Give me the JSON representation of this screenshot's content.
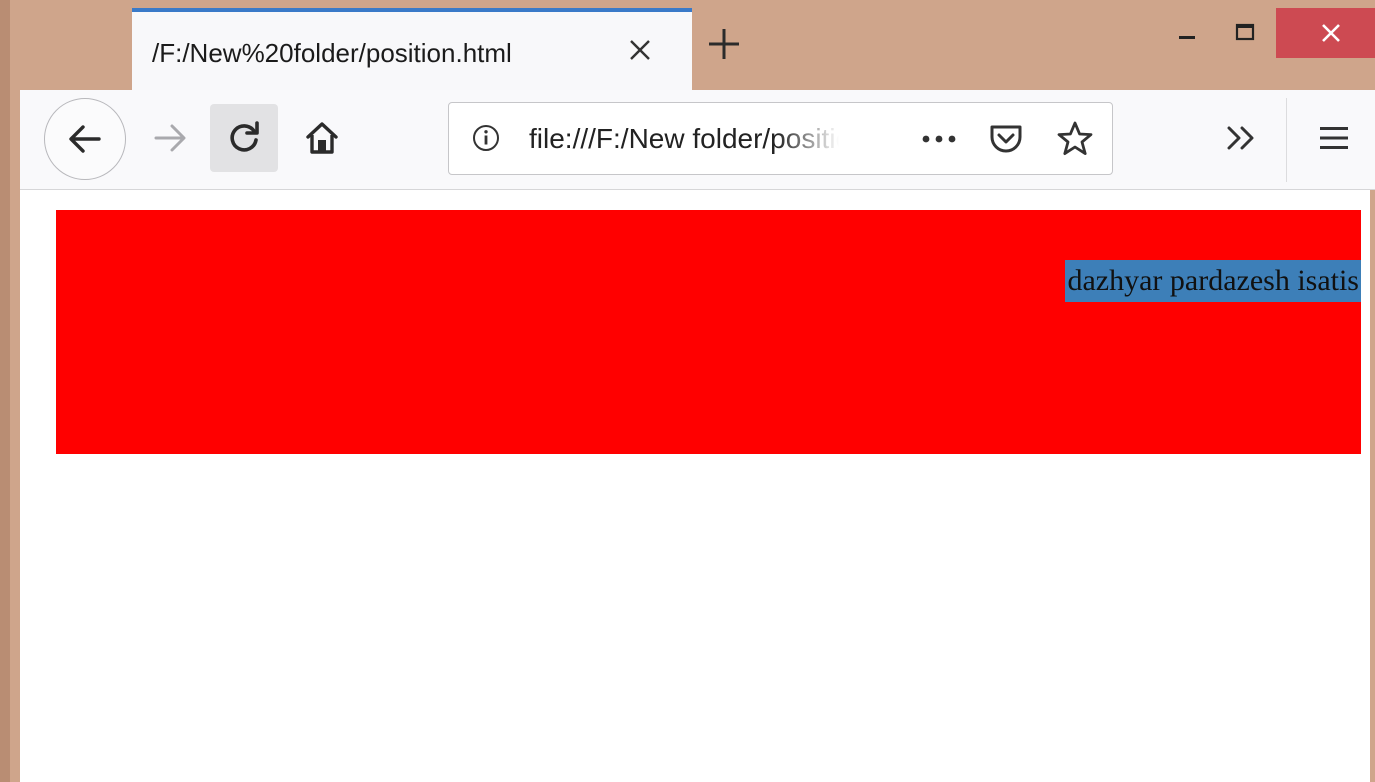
{
  "tab": {
    "title": "/F:/New%20folder/position.html"
  },
  "toolbar": {
    "url": "file:///F:/New folder/position.html"
  },
  "page": {
    "selected_text": "dazhyar pardazesh isatis"
  },
  "colors": {
    "tab_accent": "#3a7ac8",
    "window_frame": "#cfa58b",
    "close_button": "#cd4a52",
    "red_box": "#ff0000",
    "selection_highlight": "#3d7fb8"
  },
  "icons": {
    "tab_close": "close-icon",
    "new_tab": "plus-icon",
    "minimize": "minimize-icon",
    "maximize": "maximize-icon",
    "window_close": "close-icon",
    "back": "arrow-left-icon",
    "forward": "arrow-right-icon",
    "reload": "reload-icon",
    "home": "home-icon",
    "site_info": "info-icon",
    "page_actions": "ellipsis-icon",
    "pocket": "pocket-icon",
    "bookmark": "star-icon",
    "overflow": "double-chevron-right-icon",
    "menu": "hamburger-menu-icon"
  }
}
